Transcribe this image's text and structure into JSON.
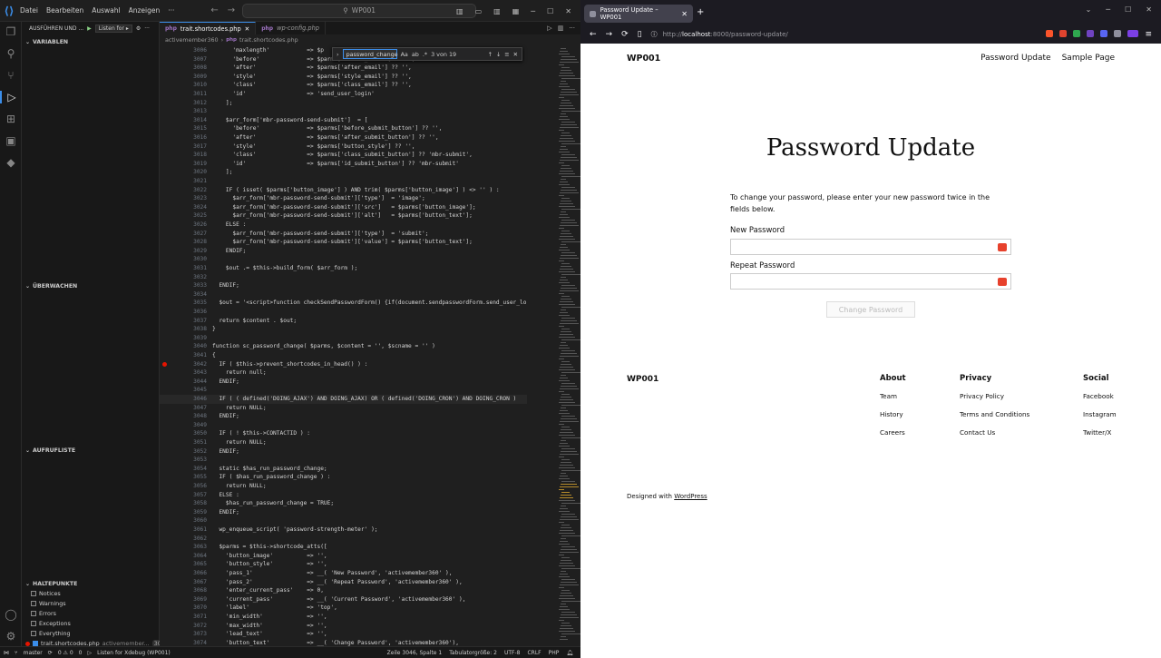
{
  "vscode": {
    "menu": [
      "Datei",
      "Bearbeiten",
      "Auswahl",
      "Anzeigen"
    ],
    "search_placeholder": "WP001",
    "run_section": "AUSFÜHREN UND ...",
    "run_config": "Listen for ▸",
    "sections": {
      "variables": "VARIABLEN",
      "watch": "ÜBERWACHEN",
      "callstack": "AUFRUFLISTE",
      "breakpoints": "HALTEPUNKTE"
    },
    "breakpoints": [
      {
        "label": "Notices",
        "checked": false
      },
      {
        "label": "Warnings",
        "checked": false
      },
      {
        "label": "Errors",
        "checked": false
      },
      {
        "label": "Exceptions",
        "checked": false
      },
      {
        "label": "Everything",
        "checked": false
      },
      {
        "label": "trait.shortcodes.php",
        "detail": "activemember...",
        "count": "3042",
        "checked": true
      }
    ],
    "tabs": [
      {
        "label": "trait.shortcodes.php",
        "active": true
      },
      {
        "label": "wp-config.php",
        "active": false
      }
    ],
    "breadcrumb": [
      "activemember360",
      "trait.shortcodes.php"
    ],
    "find": {
      "value": "password_change",
      "count": "3 von 19"
    },
    "code": [
      {
        "n": "3006",
        "t": "      'maxlength'           => $p"
      },
      {
        "n": "3007",
        "t": "      'before'              => $parms['before_email'] ?? '',"
      },
      {
        "n": "3008",
        "t": "      'after'               => $parms['after_email'] ?? '',"
      },
      {
        "n": "3009",
        "t": "      'style'               => $parms['style_email'] ?? '',"
      },
      {
        "n": "3010",
        "t": "      'class'               => $parms['class_email'] ?? '',"
      },
      {
        "n": "3011",
        "t": "      'id'                  => 'send_user_login'"
      },
      {
        "n": "3012",
        "t": "    ];"
      },
      {
        "n": "3013",
        "t": ""
      },
      {
        "n": "3014",
        "t": "    $arr_form['mbr-password-send-submit']  = ["
      },
      {
        "n": "3015",
        "t": "      'before'              => $parms['before_submit_button'] ?? '',"
      },
      {
        "n": "3016",
        "t": "      'after'               => $parms['after_submit_button'] ?? '',"
      },
      {
        "n": "3017",
        "t": "      'style'               => $parms['button_style'] ?? '',"
      },
      {
        "n": "3018",
        "t": "      'class'               => $parms['class_submit_button'] ?? 'mbr-submit',"
      },
      {
        "n": "3019",
        "t": "      'id'                  => $parms['id_submit_button'] ?? 'mbr-submit'"
      },
      {
        "n": "3020",
        "t": "    ];"
      },
      {
        "n": "3021",
        "t": ""
      },
      {
        "n": "3022",
        "t": "    IF ( isset( $parms['button_image'] ) AND trim( $parms['button_image'] ) <> '' ) :"
      },
      {
        "n": "3023",
        "t": "      $arr_form['mbr-password-send-submit']['type']  = 'image';"
      },
      {
        "n": "3024",
        "t": "      $arr_form['mbr-password-send-submit']['src']   = $parms['button_image'];"
      },
      {
        "n": "3025",
        "t": "      $arr_form['mbr-password-send-submit']['alt']   = $parms['button_text'];"
      },
      {
        "n": "3026",
        "t": "    ELSE :"
      },
      {
        "n": "3027",
        "t": "      $arr_form['mbr-password-send-submit']['type']  = 'submit';"
      },
      {
        "n": "3028",
        "t": "      $arr_form['mbr-password-send-submit']['value'] = $parms['button_text'];"
      },
      {
        "n": "3029",
        "t": "    ENDIF;"
      },
      {
        "n": "3030",
        "t": ""
      },
      {
        "n": "3031",
        "t": "    $out .= $this->build_form( $arr_form );"
      },
      {
        "n": "3032",
        "t": ""
      },
      {
        "n": "3033",
        "t": "  ENDIF;"
      },
      {
        "n": "3034",
        "t": ""
      },
      {
        "n": "3035",
        "t": "  $out = '<script>function checkSendPasswordForm() {if(document.sendpasswordForm.send_user_lo"
      },
      {
        "n": "3036",
        "t": ""
      },
      {
        "n": "3037",
        "t": "  return $content . $out;"
      },
      {
        "n": "3038",
        "t": "}"
      },
      {
        "n": "3039",
        "t": ""
      },
      {
        "n": "3040",
        "t": "function sc_password_change( $parms, $content = '', $scname = '' )"
      },
      {
        "n": "3041",
        "t": "{"
      },
      {
        "n": "3042",
        "t": "  IF ( $this->prevent_shortcodes_in_head() ) :"
      },
      {
        "n": "3043",
        "t": "    return null;"
      },
      {
        "n": "3044",
        "t": "  ENDIF;"
      },
      {
        "n": "3045",
        "t": ""
      },
      {
        "n": "3046",
        "t": "  IF ( ( defined('DOING_AJAX') AND DOING_AJAX) OR ( defined('DOING_CRON') AND DOING_CRON )"
      },
      {
        "n": "3047",
        "t": "    return NULL;"
      },
      {
        "n": "3048",
        "t": "  ENDIF;"
      },
      {
        "n": "3049",
        "t": ""
      },
      {
        "n": "3050",
        "t": "  IF ( ! $this->CONTACTID ) :"
      },
      {
        "n": "3051",
        "t": "    return NULL;"
      },
      {
        "n": "3052",
        "t": "  ENDIF;"
      },
      {
        "n": "3053",
        "t": ""
      },
      {
        "n": "3054",
        "t": "  static $has_run_password_change;"
      },
      {
        "n": "3055",
        "t": "  IF ( $has_run_password_change ) :"
      },
      {
        "n": "3056",
        "t": "    return NULL;"
      },
      {
        "n": "3057",
        "t": "  ELSE :"
      },
      {
        "n": "3058",
        "t": "    $has_run_password_change = TRUE;"
      },
      {
        "n": "3059",
        "t": "  ENDIF;"
      },
      {
        "n": "3060",
        "t": ""
      },
      {
        "n": "3061",
        "t": "  wp_enqueue_script( 'password-strength-meter' );"
      },
      {
        "n": "3062",
        "t": ""
      },
      {
        "n": "3063",
        "t": "  $parms = $this->shortcode_atts(["
      },
      {
        "n": "3064",
        "t": "    'button_image'          => '',"
      },
      {
        "n": "3065",
        "t": "    'button_style'          => '',"
      },
      {
        "n": "3066",
        "t": "    'pass_1'                => __( 'New Password', 'activemember360' ),"
      },
      {
        "n": "3067",
        "t": "    'pass_2'                => __( 'Repeat Password', 'activemember360' ),"
      },
      {
        "n": "3068",
        "t": "    'enter_current_pass'    => 0,"
      },
      {
        "n": "3069",
        "t": "    'current_pass'          => __( 'Current Password', 'activemember360' ),"
      },
      {
        "n": "3070",
        "t": "    'label'                 => 'top',"
      },
      {
        "n": "3071",
        "t": "    'min_width'             => '',"
      },
      {
        "n": "3072",
        "t": "    'max_width'             => '',"
      },
      {
        "n": "3073",
        "t": "    'lead_text'             => '',"
      },
      {
        "n": "3074",
        "t": "    'button_text'           => __( 'Change Password', 'activemember360'),"
      }
    ],
    "status": {
      "branch": "master",
      "problems": "0 ⚠ 0",
      "ports": "0",
      "debug": "Listen for Xdebug (WP001)",
      "position": "Zeile 3046, Spalte 1",
      "tabsize": "Tabulatorgröße: 2",
      "encoding": "UTF-8",
      "eol": "CRLF",
      "lang": "PHP"
    }
  },
  "browser": {
    "tab_title": "Password Update – WP001",
    "url_host": "localhost",
    "url_path": ":8000/password-update/",
    "url_prefix": "http://"
  },
  "page": {
    "site_title": "WP001",
    "nav": [
      "Password Update",
      "Sample Page"
    ],
    "heading": "Password Update",
    "intro": "To change your password, please enter your new password twice in the fields below.",
    "new_password_label": "New Password",
    "repeat_password_label": "Repeat Password",
    "submit_label": "Change Password",
    "footer": {
      "site_title": "WP001",
      "columns": [
        {
          "title": "About",
          "links": [
            "Team",
            "History",
            "Careers"
          ]
        },
        {
          "title": "Privacy",
          "links": [
            "Privacy Policy",
            "Terms and Conditions",
            "Contact Us"
          ]
        },
        {
          "title": "Social",
          "links": [
            "Facebook",
            "Instagram",
            "Twitter/X"
          ]
        }
      ],
      "credit_prefix": "Designed with",
      "credit_link": "WordPress"
    }
  }
}
